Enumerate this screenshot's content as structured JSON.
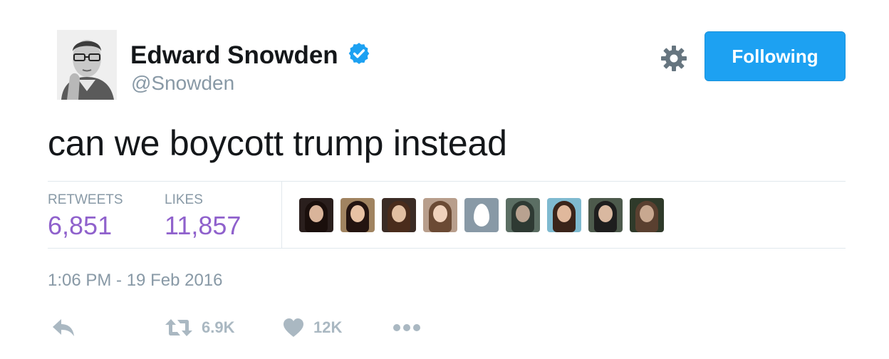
{
  "author": {
    "name": "Edward Snowden",
    "handle": "@Snowden",
    "verified": true
  },
  "follow_button": {
    "label": "Following",
    "color": "#1da1f2"
  },
  "tweet": {
    "text": "can we boycott trump instead"
  },
  "stats": {
    "retweets": {
      "label": "RETWEETS",
      "value": "6,851"
    },
    "likes": {
      "label": "LIKES",
      "value": "11,857"
    },
    "value_color": "#8f61cc"
  },
  "likers": [
    {
      "kind": "photo",
      "bg": "#2a1f1d",
      "hair": "#1a0f0c",
      "skin": "#d9b49a"
    },
    {
      "kind": "photo",
      "bg": "#a08360",
      "hair": "#241410",
      "skin": "#e8c2a4"
    },
    {
      "kind": "photo",
      "bg": "#3b2c25",
      "hair": "#4a2c1c",
      "skin": "#e2bfa2"
    },
    {
      "kind": "photo",
      "bg": "#b89e8c",
      "hair": "#6b4a34",
      "skin": "#f0d2bc"
    },
    {
      "kind": "egg"
    },
    {
      "kind": "photo",
      "bg": "#5b6e63",
      "hair": "#2e3a33",
      "skin": "#b8a290"
    },
    {
      "kind": "photo",
      "bg": "#7fbad0",
      "hair": "#3a241a",
      "skin": "#e0b89c"
    },
    {
      "kind": "photo",
      "bg": "#4d5a4c",
      "hair": "#1e1e1e",
      "skin": "#d9b8a0"
    },
    {
      "kind": "photo",
      "bg": "#2f3a2a",
      "hair": "#5a4030",
      "skin": "#c8a890"
    }
  ],
  "timestamp": "1:06 PM - 19 Feb 2016",
  "actions": {
    "reply": {
      "icon": "reply-icon"
    },
    "retweet": {
      "icon": "retweet-icon",
      "count": "6.9K"
    },
    "like": {
      "icon": "heart-icon",
      "count": "12K"
    },
    "more": {
      "icon": "more-icon"
    },
    "icon_color": "#aab8c2"
  }
}
